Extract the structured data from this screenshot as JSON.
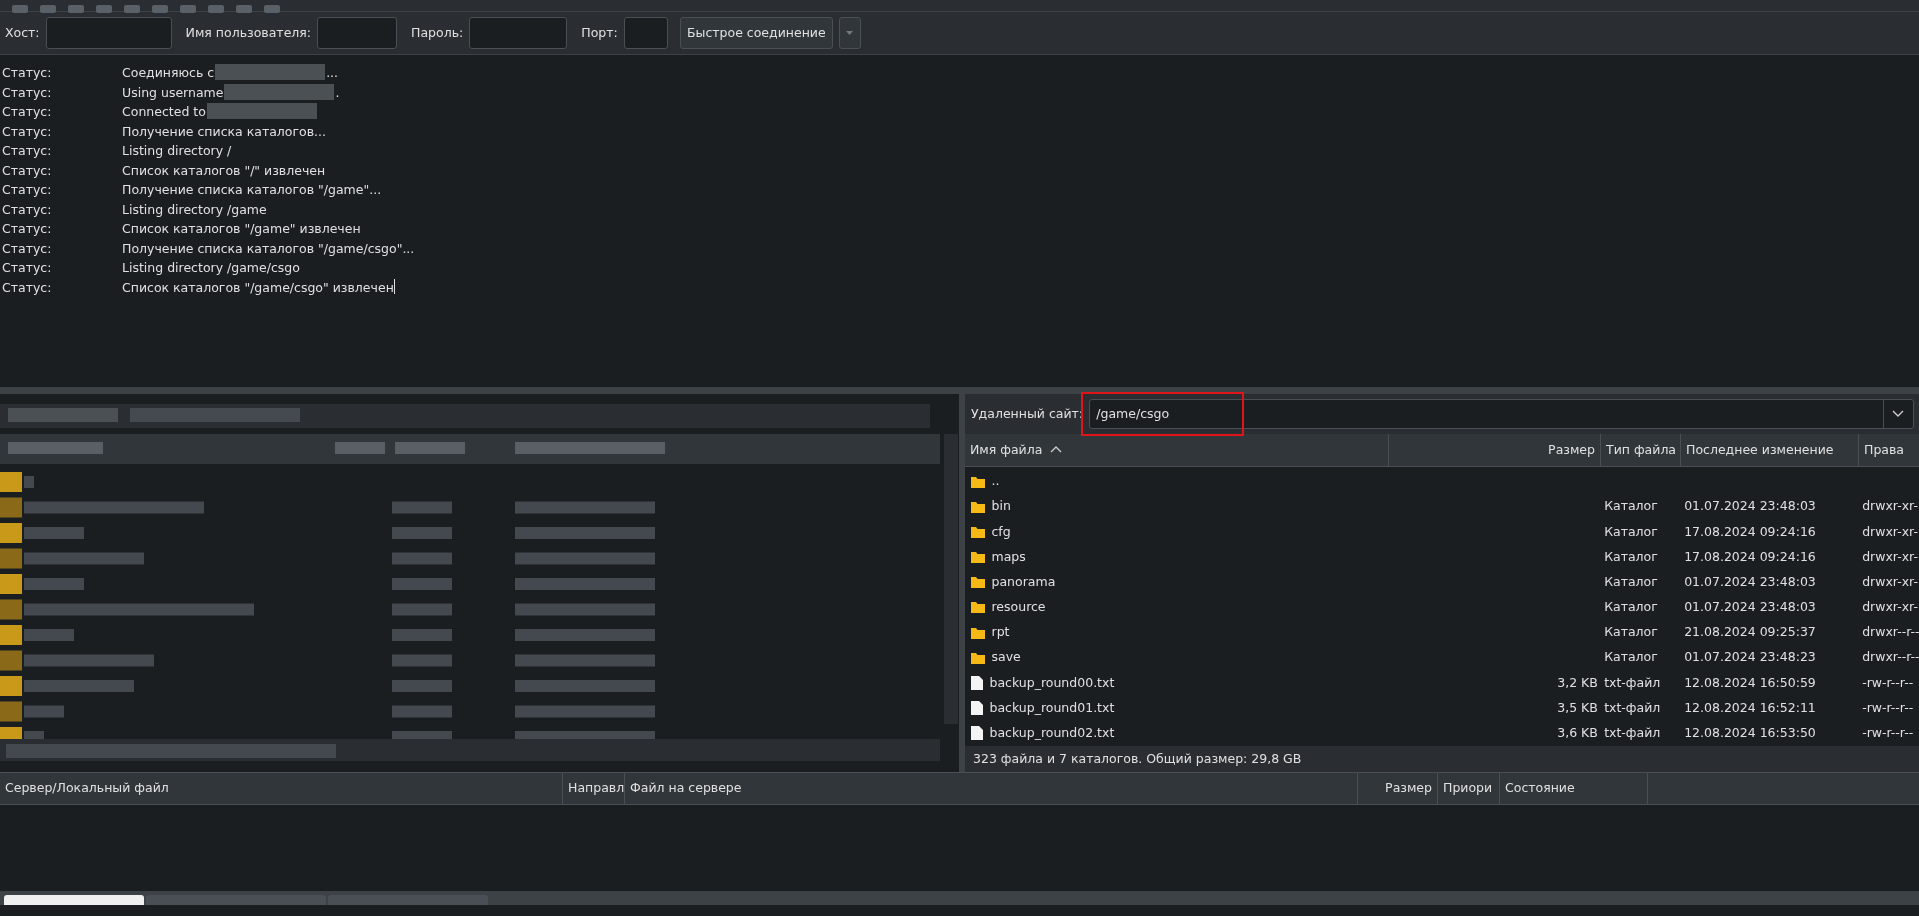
{
  "quickconnect": {
    "fields": [
      {
        "label": "Хост:"
      },
      {
        "label": "Имя пользователя:"
      },
      {
        "label": "Пароль:"
      },
      {
        "label": "Порт:"
      }
    ],
    "button": "Быстрое соединение"
  },
  "log": [
    {
      "type": "Статус:",
      "text": "Соединяюсь с",
      "redacted": true,
      "suffix": "..."
    },
    {
      "type": "Статус:",
      "text": "Using username",
      "redacted": true,
      "suffix": "."
    },
    {
      "type": "Статус:",
      "text": "Connected to",
      "redacted": true
    },
    {
      "type": "Статус:",
      "text": "Получение списка каталогов..."
    },
    {
      "type": "Статус:",
      "text": "Listing directory /"
    },
    {
      "type": "Статус:",
      "text": "Список каталогов \"/\" извлечен"
    },
    {
      "type": "Статус:",
      "text": "Получение списка каталогов \"/game\"..."
    },
    {
      "type": "Статус:",
      "text": "Listing directory /game"
    },
    {
      "type": "Статус:",
      "text": "Список каталогов \"/game\" извлечен"
    },
    {
      "type": "Статус:",
      "text": "Получение списка каталогов \"/game/csgo\"..."
    },
    {
      "type": "Статус:",
      "text": "Listing directory /game/csgo"
    },
    {
      "type": "Статус:",
      "text": "Список каталогов \"/game/csgo\" извлечен",
      "cursor": true
    }
  ],
  "local_pane": {
    "kind": "redacted"
  },
  "remote": {
    "label": "Удаленный сайт:",
    "path": "/game/csgo",
    "highlighted": true,
    "columns": [
      "Имя файла",
      "Размер",
      "Тип файла",
      "Последнее изменение",
      "Права"
    ],
    "rows": [
      {
        "kind": "folder",
        "name": ".."
      },
      {
        "kind": "folder",
        "name": "bin",
        "type": "Каталог",
        "modified": "01.07.2024 23:48:03",
        "perms": "drwxr-xr-"
      },
      {
        "kind": "folder",
        "name": "cfg",
        "type": "Каталог",
        "modified": "17.08.2024 09:24:16",
        "perms": "drwxr-xr-"
      },
      {
        "kind": "folder",
        "name": "maps",
        "type": "Каталог",
        "modified": "17.08.2024 09:24:16",
        "perms": "drwxr-xr-"
      },
      {
        "kind": "folder",
        "name": "panorama",
        "type": "Каталог",
        "modified": "01.07.2024 23:48:03",
        "perms": "drwxr-xr-"
      },
      {
        "kind": "folder",
        "name": "resource",
        "type": "Каталог",
        "modified": "01.07.2024 23:48:03",
        "perms": "drwxr-xr-"
      },
      {
        "kind": "folder",
        "name": "rpt",
        "type": "Каталог",
        "modified": "21.08.2024 09:25:37",
        "perms": "drwxr--r--"
      },
      {
        "kind": "folder",
        "name": "save",
        "type": "Каталог",
        "modified": "01.07.2024 23:48:23",
        "perms": "drwxr--r--"
      },
      {
        "kind": "file",
        "name": "backup_round00.txt",
        "size": "3,2 KB",
        "type": "txt-файл",
        "modified": "12.08.2024 16:50:59",
        "perms": "-rw-r--r--"
      },
      {
        "kind": "file",
        "name": "backup_round01.txt",
        "size": "3,5 KB",
        "type": "txt-файл",
        "modified": "12.08.2024 16:52:11",
        "perms": "-rw-r--r--"
      },
      {
        "kind": "file",
        "name": "backup_round02.txt",
        "size": "3,6 KB",
        "type": "txt-файл",
        "modified": "12.08.2024 16:53:50",
        "perms": "-rw-r--r--"
      }
    ],
    "status": "323 файла и 7 каталогов. Общий размер: 29,8 GB"
  },
  "queue": {
    "columns": [
      "Сервер/Локальный файл",
      "Направл",
      "Файл на сервере",
      "Размер",
      "Приори",
      "Состояние"
    ],
    "tabs": [
      {
        "selected": true
      },
      {
        "selected": false
      },
      {
        "selected": false
      }
    ]
  }
}
